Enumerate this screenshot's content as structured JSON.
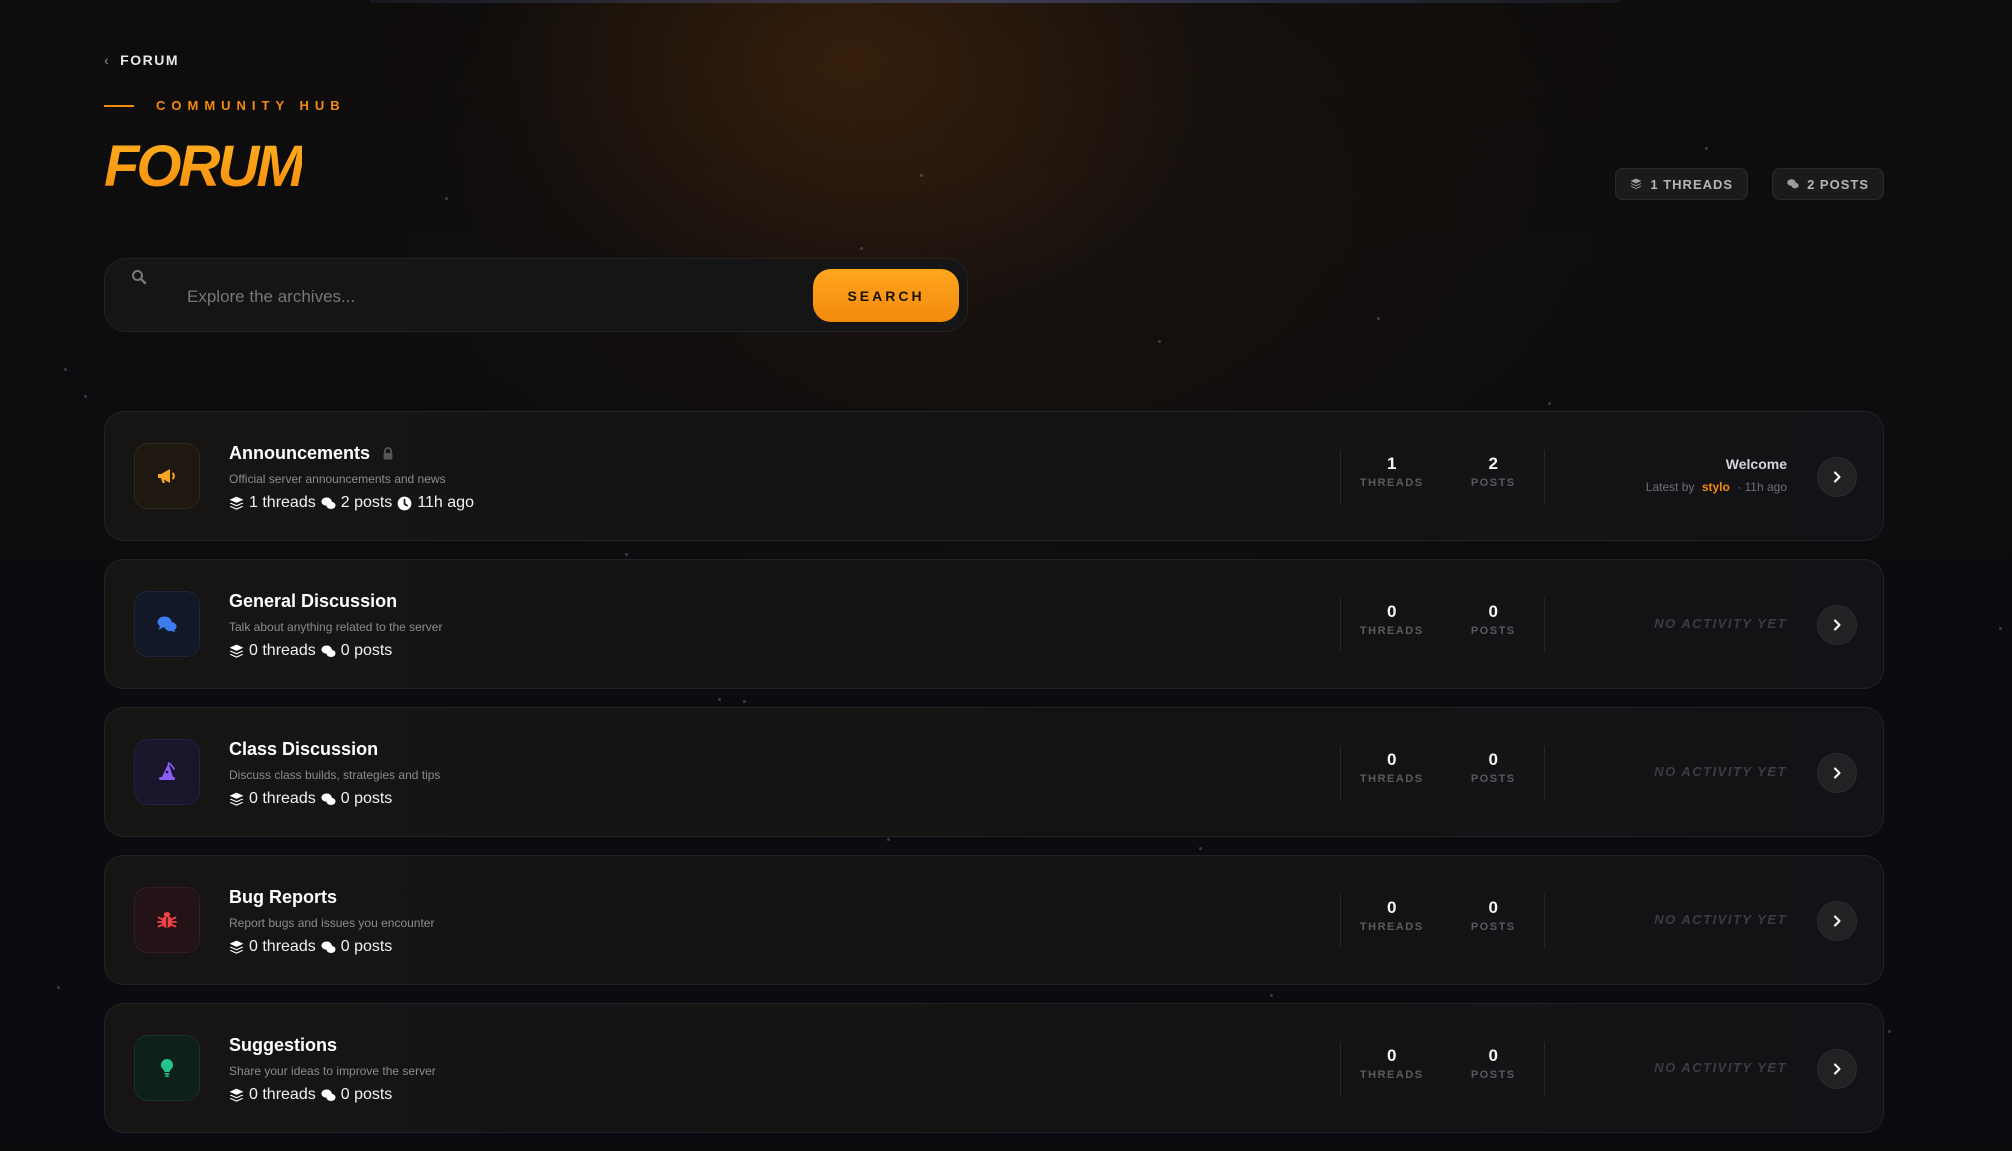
{
  "breadcrumb": {
    "label": "FORUM"
  },
  "header": {
    "eyebrow": "COMMUNITY HUB",
    "title": "FORUM",
    "stats": {
      "threads": "1 THREADS",
      "posts": "2 POSTS"
    }
  },
  "search": {
    "placeholder": "Explore the archives...",
    "button_label": "SEARCH"
  },
  "labels": {
    "threads": "THREADS",
    "posts": "POSTS",
    "no_activity": "NO ACTIVITY YET"
  },
  "colors": {
    "accent": "#f28a12",
    "background": "#0c0c0f"
  },
  "categories": [
    {
      "name": "Announcements",
      "description": "Official server announcements and news",
      "icon": "megaphone-icon",
      "locked": true,
      "threads_text": "1 threads",
      "posts_text": "2 posts",
      "time_text": "11h ago",
      "threads": "1",
      "posts": "2",
      "latest": {
        "title": "Welcome",
        "prefix": "Latest by",
        "user": "stylo",
        "time": "· 11h ago"
      }
    },
    {
      "name": "General Discussion",
      "description": "Talk about anything related to the server",
      "icon": "chat-bubbles-icon",
      "threads_text": "0 threads",
      "posts_text": "0 posts",
      "threads": "0",
      "posts": "0"
    },
    {
      "name": "Class Discussion",
      "description": "Discuss class builds, strategies and tips",
      "icon": "wizard-hat-icon",
      "threads_text": "0 threads",
      "posts_text": "0 posts",
      "threads": "0",
      "posts": "0"
    },
    {
      "name": "Bug Reports",
      "description": "Report bugs and issues you encounter",
      "icon": "bug-icon",
      "threads_text": "0 threads",
      "posts_text": "0 posts",
      "threads": "0",
      "posts": "0"
    },
    {
      "name": "Suggestions",
      "description": "Share your ideas to improve the server",
      "icon": "lightbulb-icon",
      "threads_text": "0 threads",
      "posts_text": "0 posts",
      "threads": "0",
      "posts": "0"
    }
  ]
}
